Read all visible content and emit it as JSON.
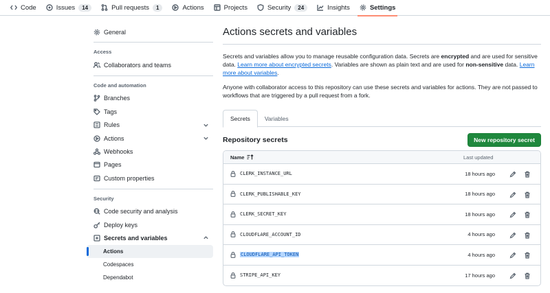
{
  "topnav": {
    "tabs": [
      {
        "label": "Code",
        "icon": "code-icon"
      },
      {
        "label": "Issues",
        "count": "14",
        "icon": "issue-icon"
      },
      {
        "label": "Pull requests",
        "count": "1",
        "icon": "pull-request-icon"
      },
      {
        "label": "Actions",
        "icon": "play-icon"
      },
      {
        "label": "Projects",
        "icon": "table-icon"
      },
      {
        "label": "Security",
        "count": "24",
        "icon": "shield-icon"
      },
      {
        "label": "Insights",
        "icon": "graph-icon"
      },
      {
        "label": "Settings",
        "icon": "gear-icon",
        "active": true
      }
    ]
  },
  "sidebar": {
    "general": "General",
    "access_heading": "Access",
    "collaborators": "Collaborators and teams",
    "code_heading": "Code and automation",
    "branches": "Branches",
    "tags": "Tags",
    "rules": "Rules",
    "actions": "Actions",
    "webhooks": "Webhooks",
    "pages": "Pages",
    "custom_properties": "Custom properties",
    "security_heading": "Security",
    "code_security": "Code security and analysis",
    "deploy_keys": "Deploy keys",
    "secrets_vars": "Secrets and variables",
    "sub_actions": "Actions",
    "sub_codespaces": "Codespaces",
    "sub_dependabot": "Dependabot"
  },
  "main": {
    "title": "Actions secrets and variables",
    "desc_1": "Secrets and variables allow you to manage reusable configuration data. Secrets are ",
    "desc_encrypted": "encrypted",
    "desc_2": " and are used for sensitive data. ",
    "desc_link1": "Learn more about encrypted secrets",
    "desc_3": ". Variables are shown as plain text and are used for ",
    "desc_nonsensitive": "non-sensitive",
    "desc_4": " data. ",
    "desc_link2": "Learn more about variables",
    "desc_5": ".",
    "desc_p2": "Anyone with collaborator access to this repository can use these secrets and variables for actions. They are not passed to workflows that are triggered by a pull request from a fork.",
    "tab_secrets": "Secrets",
    "tab_variables": "Variables",
    "section_title": "Repository secrets",
    "new_secret_button": "New repository secret",
    "col_name": "Name",
    "col_last_updated": "Last updated",
    "secrets": [
      {
        "name": "CLERK_INSTANCE_URL",
        "updated": "18 hours ago"
      },
      {
        "name": "CLERK_PUBLISHABLE_KEY",
        "updated": "18 hours ago"
      },
      {
        "name": "CLERK_SECRET_KEY",
        "updated": "18 hours ago"
      },
      {
        "name": "CLOUDFLARE_ACCOUNT_ID",
        "updated": "4 hours ago"
      },
      {
        "name": "CLOUDFLARE_API_TOKEN",
        "updated": "4 hours ago",
        "selected": true
      },
      {
        "name": "STRIPE_API_KEY",
        "updated": "17 hours ago"
      }
    ]
  }
}
